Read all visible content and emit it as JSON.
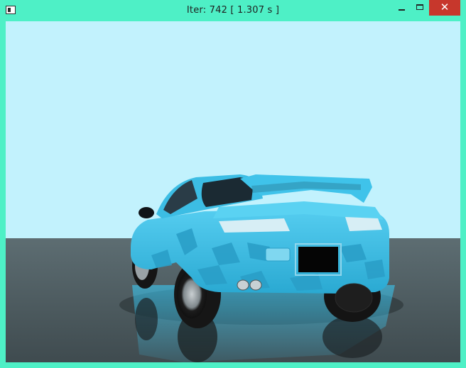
{
  "window": {
    "title": "Iter: 742 [ 1.307 s ]",
    "icon": "app-window-icon",
    "controls": {
      "minimize_icon": "minimize-icon",
      "maximize_icon": "maximize-icon",
      "close_icon": "close-icon",
      "close_glyph": "✕"
    }
  },
  "render": {
    "sky_color": "#c2f2fd",
    "floor_color": "#56666b",
    "car_color": "#3cbde4",
    "subject": "blue sports car rear view render"
  }
}
